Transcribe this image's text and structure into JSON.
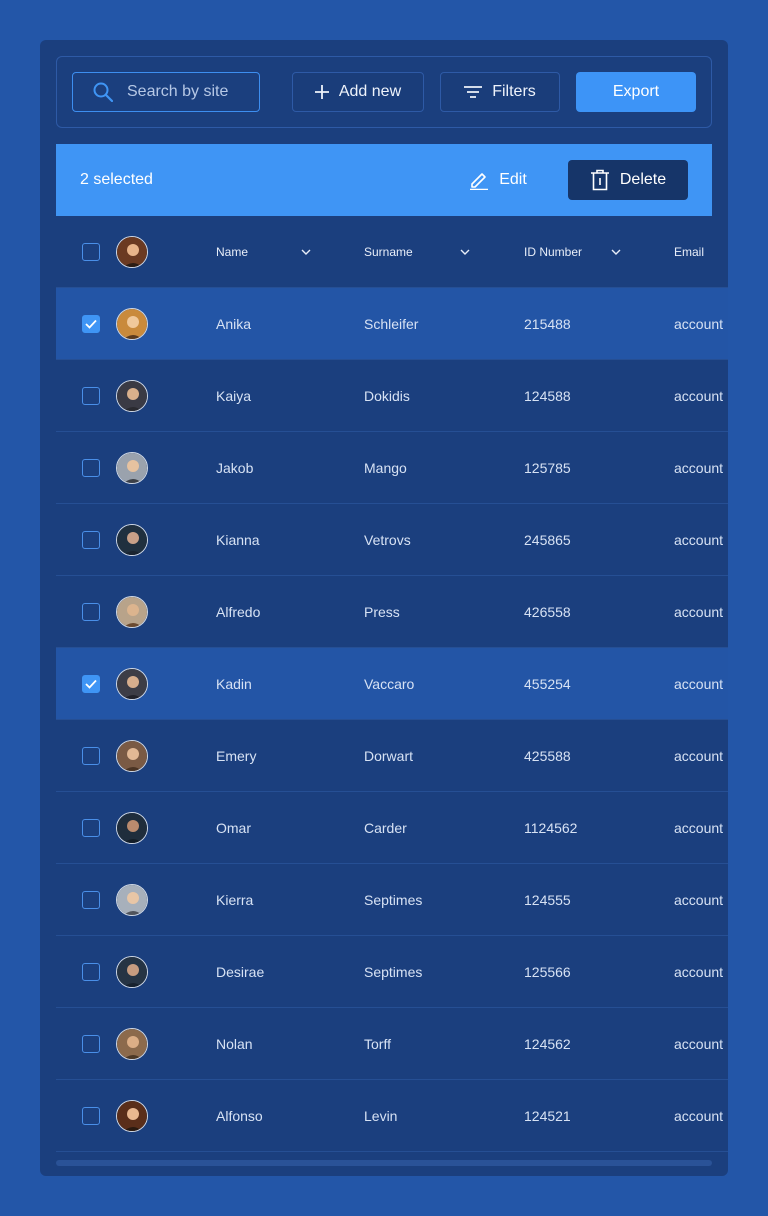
{
  "toolbar": {
    "search_placeholder": "Search by site",
    "add_label": "Add new",
    "filters_label": "Filters",
    "export_label": "Export"
  },
  "selection": {
    "count_label": "2 selected",
    "edit_label": "Edit",
    "delete_label": "Delete"
  },
  "table": {
    "columns": [
      "Name",
      "Surname",
      "ID Number",
      "Email"
    ],
    "rows": [
      {
        "name": "Anika",
        "surname": "Schleifer",
        "id": "215488",
        "email": "account",
        "selected": true
      },
      {
        "name": "Kaiya",
        "surname": "Dokidis",
        "id": "124588",
        "email": "account",
        "selected": false
      },
      {
        "name": "Jakob",
        "surname": "Mango",
        "id": "125785",
        "email": "account",
        "selected": false
      },
      {
        "name": "Kianna",
        "surname": "Vetrovs",
        "id": "245865",
        "email": "account",
        "selected": false
      },
      {
        "name": "Alfredo",
        "surname": "Press",
        "id": "426558",
        "email": "account",
        "selected": false
      },
      {
        "name": "Kadin",
        "surname": "Vaccaro",
        "id": "455254",
        "email": "account",
        "selected": true
      },
      {
        "name": "Emery",
        "surname": "Dorwart",
        "id": "425588",
        "email": "account",
        "selected": false
      },
      {
        "name": "Omar",
        "surname": "Carder",
        "id": "1124562",
        "email": "account",
        "selected": false
      },
      {
        "name": "Kierra",
        "surname": "Septimes",
        "id": "124555",
        "email": "account",
        "selected": false
      },
      {
        "name": "Desirae",
        "surname": "Septimes",
        "id": "125566",
        "email": "account",
        "selected": false
      },
      {
        "name": "Nolan",
        "surname": "Torff",
        "id": "124562",
        "email": "account",
        "selected": false
      },
      {
        "name": "Alfonso",
        "surname": "Levin",
        "id": "124521",
        "email": "account",
        "selected": false
      }
    ]
  },
  "colors": {
    "background": "#2356a8",
    "panel": "#1b3f7e",
    "accent": "#3f95f5",
    "selected_row": "#2355a6"
  }
}
